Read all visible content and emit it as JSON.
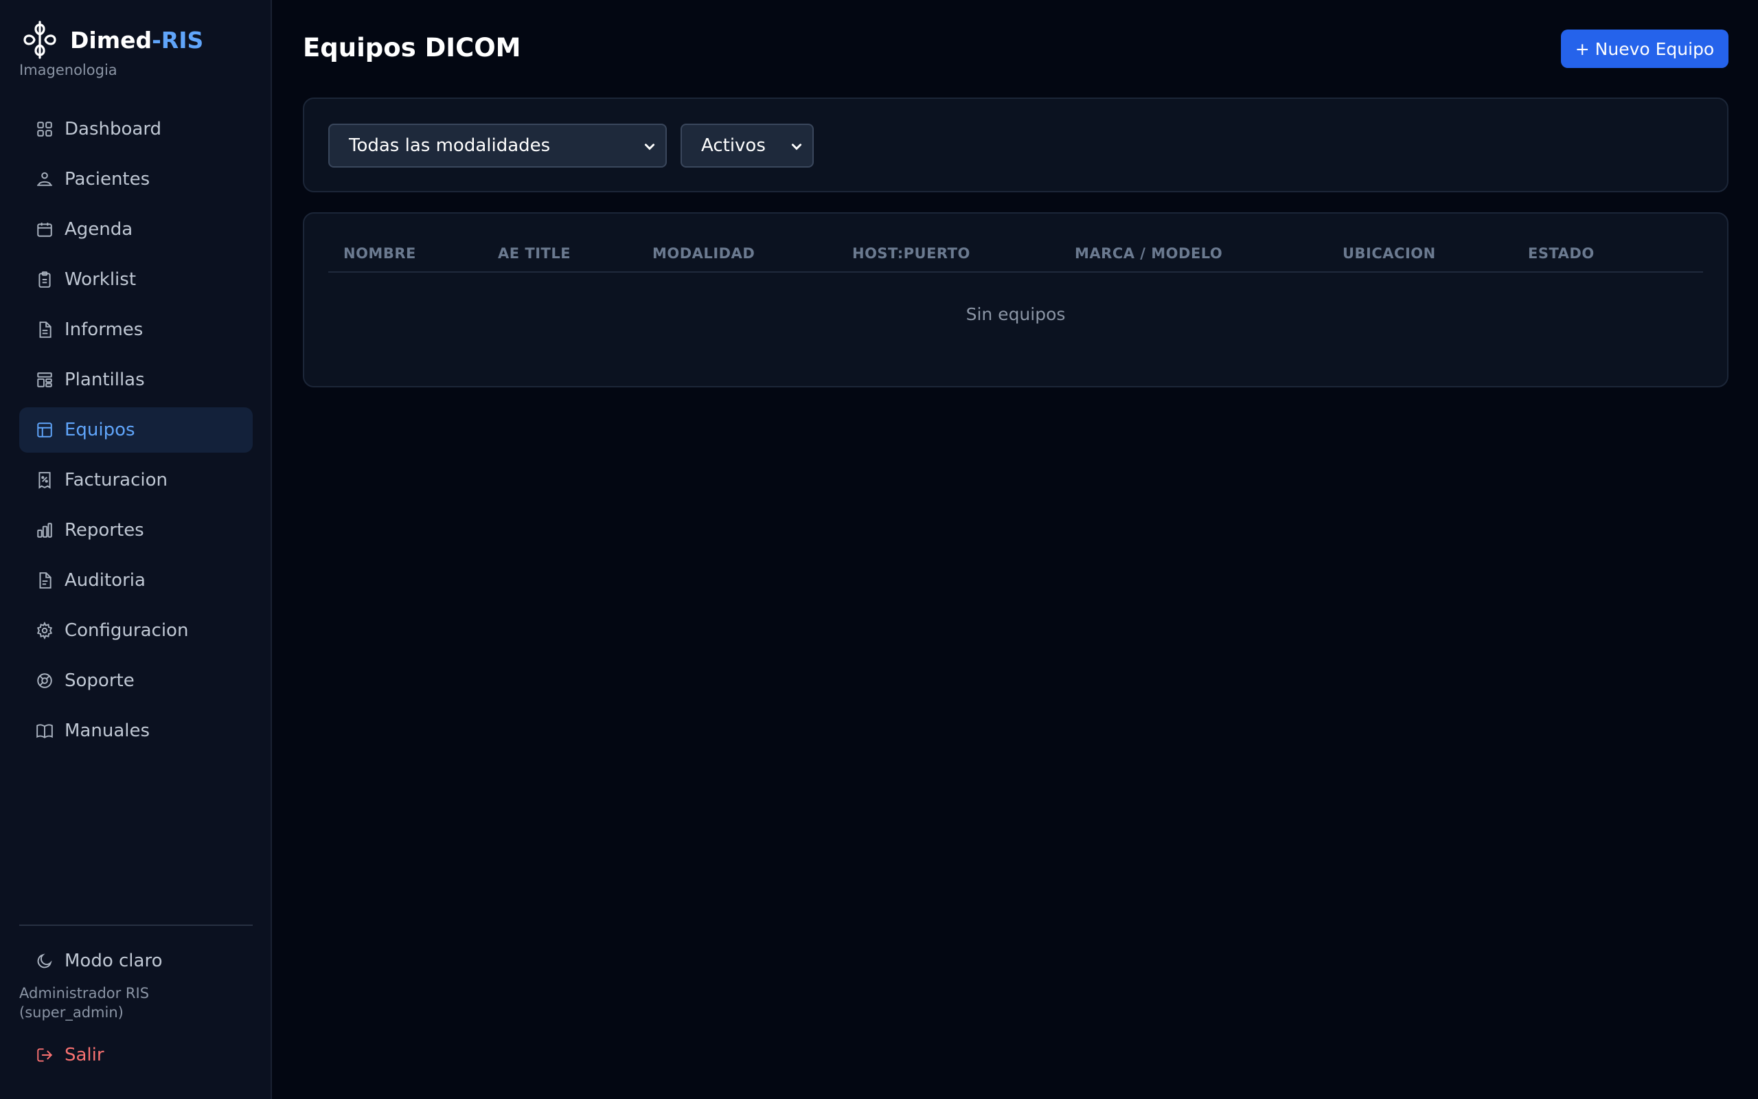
{
  "brand": {
    "name_main": "Dimed",
    "name_accent": "-RIS",
    "subtitle": "Imagenologia"
  },
  "sidebar": {
    "items": [
      {
        "label": "Dashboard",
        "icon": "grid-icon"
      },
      {
        "label": "Pacientes",
        "icon": "patient-icon"
      },
      {
        "label": "Agenda",
        "icon": "calendar-icon"
      },
      {
        "label": "Worklist",
        "icon": "clipboard-icon"
      },
      {
        "label": "Informes",
        "icon": "document-icon"
      },
      {
        "label": "Plantillas",
        "icon": "template-icon"
      },
      {
        "label": "Equipos",
        "icon": "equipment-icon",
        "active": true
      },
      {
        "label": "Facturacion",
        "icon": "receipt-icon"
      },
      {
        "label": "Reportes",
        "icon": "bar-chart-icon"
      },
      {
        "label": "Auditoria",
        "icon": "audit-file-icon"
      },
      {
        "label": "Configuracion",
        "icon": "gear-icon"
      },
      {
        "label": "Soporte",
        "icon": "support-icon"
      },
      {
        "label": "Manuales",
        "icon": "book-icon"
      }
    ],
    "theme_toggle": "Modo claro",
    "user_name": "Administrador RIS",
    "user_role": "(super_admin)",
    "logout": "Salir"
  },
  "main": {
    "title": "Equipos DICOM",
    "new_button": "+ Nuevo Equipo",
    "filters": {
      "modalidad_selected": "Todas las modalidades",
      "estado_selected": "Activos"
    },
    "table": {
      "columns": [
        "NOMBRE",
        "AE TITLE",
        "MODALIDAD",
        "HOST:PUERTO",
        "MARCA / MODELO",
        "UBICACION",
        "ESTADO"
      ],
      "empty_text": "Sin equipos"
    }
  },
  "colors": {
    "accent": "#60a5fa",
    "primary_button": "#2563eb",
    "danger": "#f87171",
    "background": "#030712",
    "sidebar": "#0b1120"
  }
}
